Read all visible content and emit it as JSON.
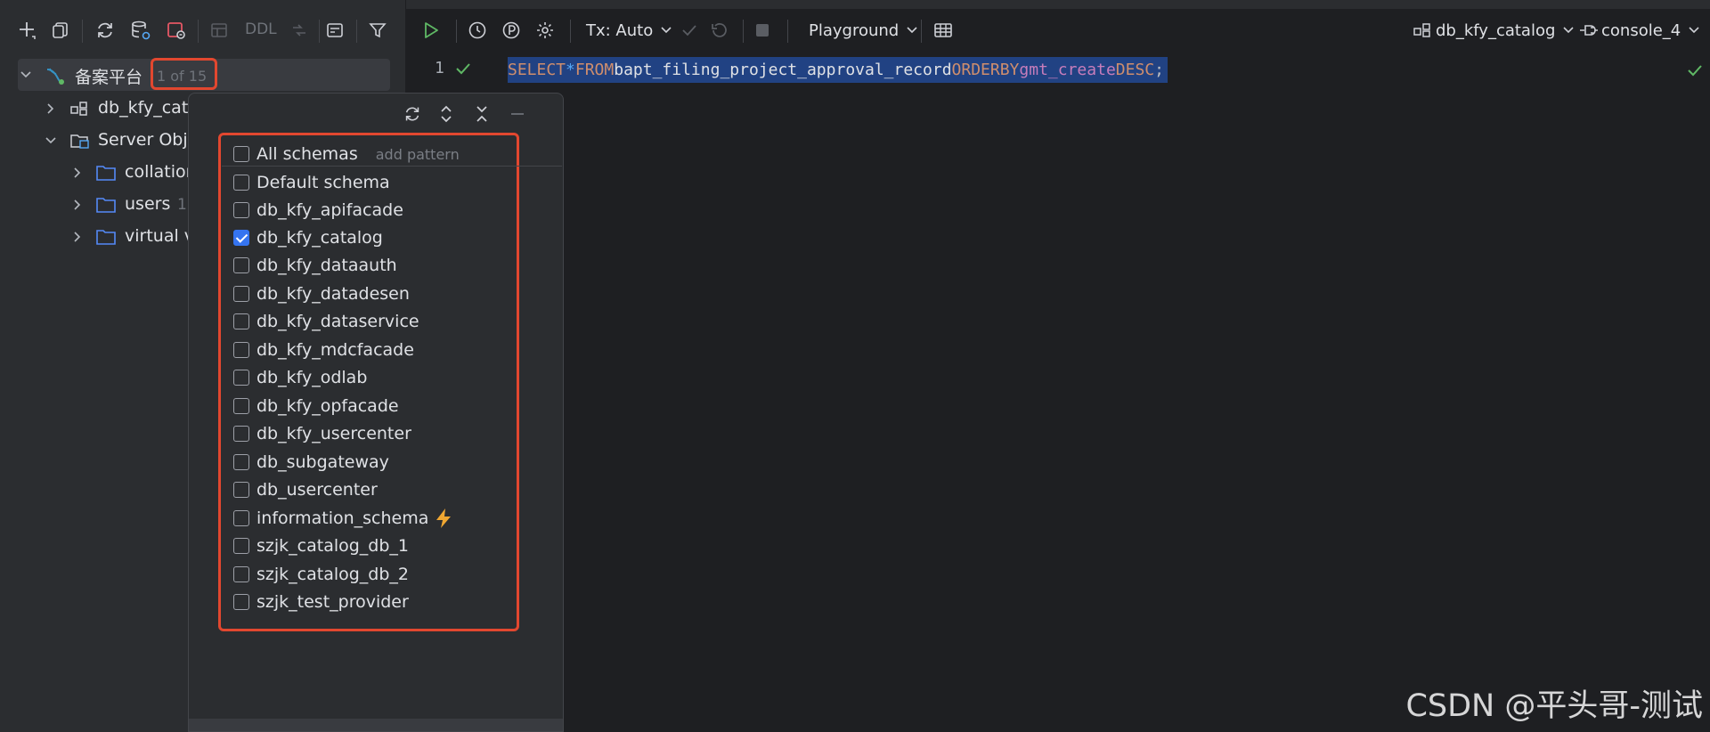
{
  "left_toolbar": {
    "ddl_label": "DDL"
  },
  "tree": {
    "root": {
      "label": "备案平台",
      "counter": "1 of 15"
    },
    "db": {
      "label": "db_kfy_cat"
    },
    "server_objects": {
      "label": "Server Obje"
    },
    "collations": {
      "label": "collation"
    },
    "users": {
      "label": "users",
      "count": "1"
    },
    "virtual": {
      "label": "virtual v"
    }
  },
  "editor_toolbar": {
    "tx_label": "Tx: Auto",
    "playground_label": "Playground",
    "schema_label": "db_kfy_catalog",
    "console_label": "console_4"
  },
  "editor": {
    "line_number": "1",
    "sql": {
      "select": "SELECT",
      "star": "*",
      "from": "FROM",
      "table": "bapt_filing_project_approval_record",
      "order": "ORDER",
      "by": "BY",
      "column": "gmt_create",
      "desc": "DESC",
      "semicolon": ";"
    }
  },
  "popup": {
    "all_schemas_label": "All schemas",
    "pattern_placeholder": "add pattern",
    "schemas": [
      {
        "name": "Default schema",
        "checked": false
      },
      {
        "name": "db_kfy_apifacade",
        "checked": false
      },
      {
        "name": "db_kfy_catalog",
        "checked": true
      },
      {
        "name": "db_kfy_dataauth",
        "checked": false
      },
      {
        "name": "db_kfy_datadesen",
        "checked": false
      },
      {
        "name": "db_kfy_dataservice",
        "checked": false
      },
      {
        "name": "db_kfy_mdcfacade",
        "checked": false
      },
      {
        "name": "db_kfy_odlab",
        "checked": false
      },
      {
        "name": "db_kfy_opfacade",
        "checked": false
      },
      {
        "name": "db_kfy_usercenter",
        "checked": false
      },
      {
        "name": "db_subgateway",
        "checked": false
      },
      {
        "name": "db_usercenter",
        "checked": false
      },
      {
        "name": "information_schema",
        "checked": false,
        "icon": "bolt-icon"
      },
      {
        "name": "szjk_catalog_db_1",
        "checked": false
      },
      {
        "name": "szjk_catalog_db_2",
        "checked": false
      },
      {
        "name": "szjk_test_provider",
        "checked": false
      }
    ]
  },
  "watermark": "CSDN @平头哥-测试",
  "colors": {
    "accent": "#3574f0",
    "highlight_border": "#e2472f",
    "selection": "#214283"
  }
}
